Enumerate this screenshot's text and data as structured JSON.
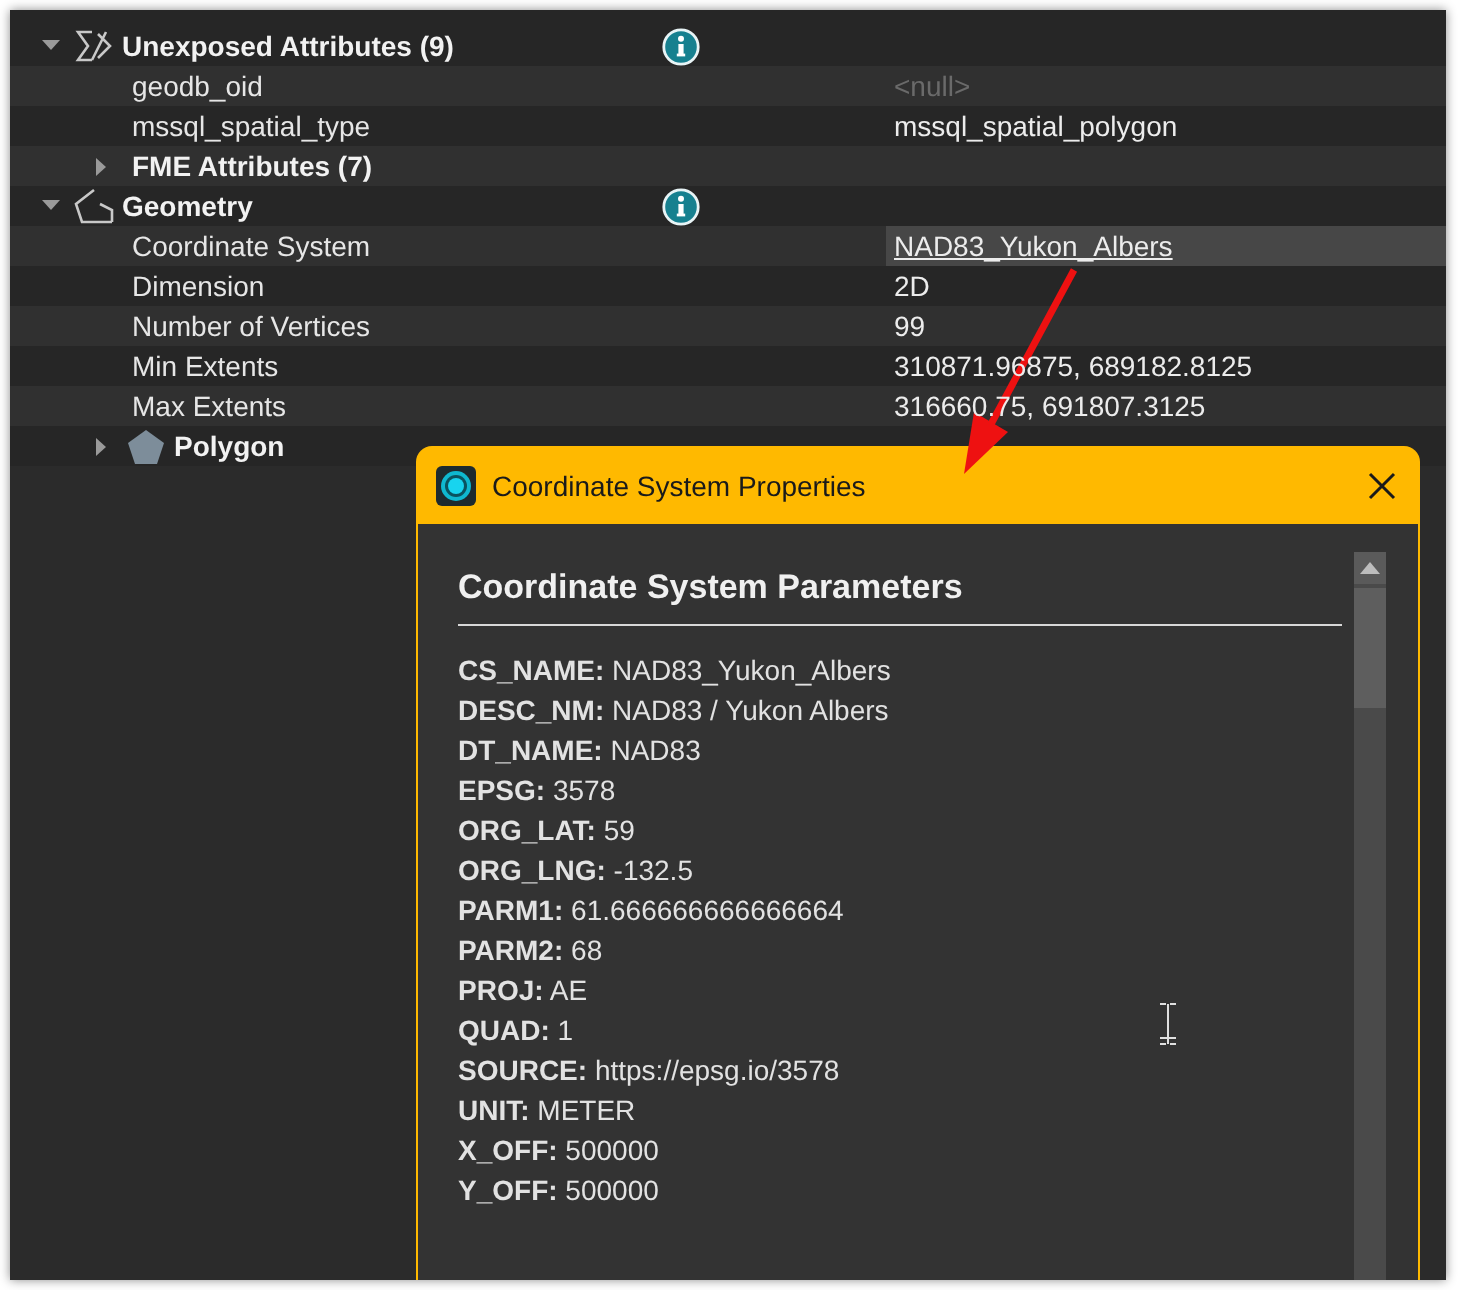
{
  "tree": [
    {
      "kind": "attributes",
      "label": "Unexposed Attributes (9)",
      "expanded": true,
      "info": true,
      "children": [
        {
          "kind": "attribute",
          "name": "geodb_oid",
          "value": "<null>",
          "muted": true,
          "selected": false
        },
        {
          "kind": "attribute",
          "name": "mssql_spatial_type",
          "value": "mssql_spatial_polygon",
          "muted": false,
          "selected": false
        },
        {
          "kind": "group",
          "label": "FME Attributes (7)",
          "expanded": false,
          "info": false
        }
      ]
    },
    {
      "kind": "geometry",
      "label": "Geometry",
      "expanded": true,
      "info": true,
      "children": [
        {
          "kind": "attribute",
          "name": "Coordinate System",
          "value": "NAD83_Yukon_Albers",
          "link": true,
          "muted": false,
          "selected": true
        },
        {
          "kind": "attribute",
          "name": "Dimension",
          "value": "2D",
          "muted": false,
          "selected": false
        },
        {
          "kind": "attribute",
          "name": "Number of Vertices",
          "value": "99",
          "muted": false,
          "selected": false
        },
        {
          "kind": "attribute",
          "name": "Min Extents",
          "value": "310871.96875, 689182.8125",
          "muted": false,
          "selected": false
        },
        {
          "kind": "attribute",
          "name": "Max Extents",
          "value": "316660.75, 691807.3125",
          "muted": false,
          "selected": false
        },
        {
          "kind": "part",
          "label": "Polygon",
          "expanded": false,
          "info": false
        }
      ]
    }
  ],
  "dialog": {
    "title": "Coordinate System Properties",
    "heading": "Coordinate System Parameters",
    "parameters": [
      {
        "label": "CS_NAME:",
        "value": "NAD83_Yukon_Albers"
      },
      {
        "label": "DESC_NM:",
        "value": "NAD83 / Yukon Albers"
      },
      {
        "label": "DT_NAME:",
        "value": "NAD83"
      },
      {
        "label": "EPSG:",
        "value": "3578"
      },
      {
        "label": "ORG_LAT:",
        "value": "59"
      },
      {
        "label": "ORG_LNG:",
        "value": "-132.5"
      },
      {
        "label": "PARM1:",
        "value": "61.666666666666664"
      },
      {
        "label": "PARM2:",
        "value": "68"
      },
      {
        "label": "PROJ:",
        "value": "AE"
      },
      {
        "label": "QUAD:",
        "value": "1"
      },
      {
        "label": "SOURCE:",
        "value": "https://epsg.io/3578"
      },
      {
        "label": "UNIT:",
        "value": "METER"
      },
      {
        "label": "X_OFF:",
        "value": "500000"
      },
      {
        "label": "Y_OFF:",
        "value": "500000"
      }
    ]
  }
}
